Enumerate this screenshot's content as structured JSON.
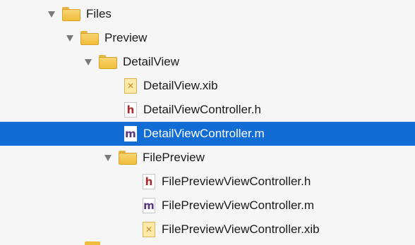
{
  "tree": {
    "items": [
      {
        "label": "Files",
        "kind": "folder",
        "expanded": true,
        "selected": false
      },
      {
        "label": "Preview",
        "kind": "folder",
        "expanded": true,
        "selected": false
      },
      {
        "label": "DetailView",
        "kind": "folder",
        "expanded": true,
        "selected": false
      },
      {
        "label": "DetailView.xib",
        "kind": "xib",
        "icon": "xib-file-icon",
        "selected": false
      },
      {
        "label": "DetailViewController.h",
        "kind": "header",
        "icon": "header-file-icon",
        "icon_letter": "h",
        "selected": false
      },
      {
        "label": "DetailViewController.m",
        "kind": "implementation",
        "icon": "implementation-file-icon",
        "icon_letter": "m",
        "selected": true
      },
      {
        "label": "FilePreview",
        "kind": "folder",
        "expanded": true,
        "selected": false
      },
      {
        "label": "FilePreviewViewController.h",
        "kind": "header",
        "icon": "header-file-icon",
        "icon_letter": "h",
        "selected": false
      },
      {
        "label": "FilePreviewViewController.m",
        "kind": "implementation",
        "icon": "implementation-file-icon",
        "icon_letter": "m",
        "selected": false
      },
      {
        "label": "FilePreviewViewController.xib",
        "kind": "xib",
        "icon": "xib-file-icon",
        "selected": false
      }
    ]
  },
  "colors": {
    "selection": "#116cd6",
    "folder": "#f0bc3b",
    "header_letter": "#b0242b",
    "implementation_letter": "#58357f",
    "background": "#f6f6f6"
  }
}
